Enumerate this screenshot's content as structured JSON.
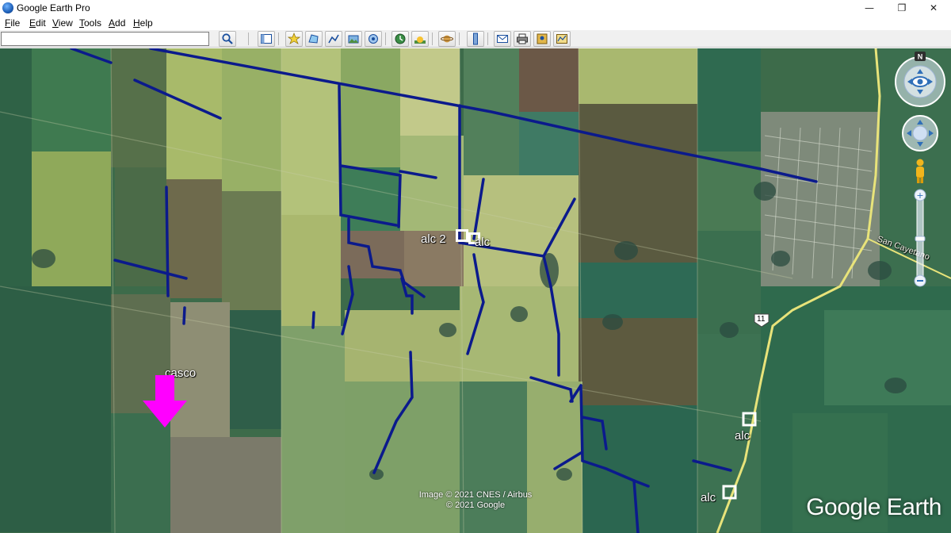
{
  "window": {
    "title": "Google Earth Pro",
    "minimize_icon": "minimize-icon",
    "restore_icon": "restore-icon",
    "close_icon": "close-icon"
  },
  "menu": {
    "items": [
      {
        "accel": "F",
        "rest": "ile"
      },
      {
        "accel": "E",
        "rest": "dit"
      },
      {
        "accel": "V",
        "rest": "iew"
      },
      {
        "accel": "T",
        "rest": "ools"
      },
      {
        "accel": "A",
        "rest": "dd"
      },
      {
        "accel": "H",
        "rest": "elp"
      }
    ]
  },
  "toolbar": {
    "search_value": "",
    "search_icon": "search-icon",
    "buttons": [
      "sidebar-toggle-icon",
      "add-placemark-icon",
      "add-polygon-icon",
      "add-path-icon",
      "add-image-overlay-icon",
      "record-tour-icon",
      "historical-imagery-icon",
      "sunlight-icon",
      "planets-icon",
      "ruler-icon",
      "email-icon",
      "print-icon",
      "save-image-icon",
      "view-in-maps-icon"
    ]
  },
  "map": {
    "labels": {
      "casco": "casco",
      "alc2": "alc 2",
      "alc_center": "alc",
      "alc_right1": "alc",
      "alc_right2": "alc",
      "road_name": "San Cayetano",
      "route_number": "11"
    },
    "attribution_line1": "Image © 2021 CNES / Airbus",
    "attribution_line2": "© 2021 Google",
    "logo": "Google Earth",
    "compass_label": "N",
    "colors": {
      "drain_lines": "#0b1a8c",
      "marker_arrow": "#ff00ff",
      "road": "#e8e37a"
    }
  }
}
